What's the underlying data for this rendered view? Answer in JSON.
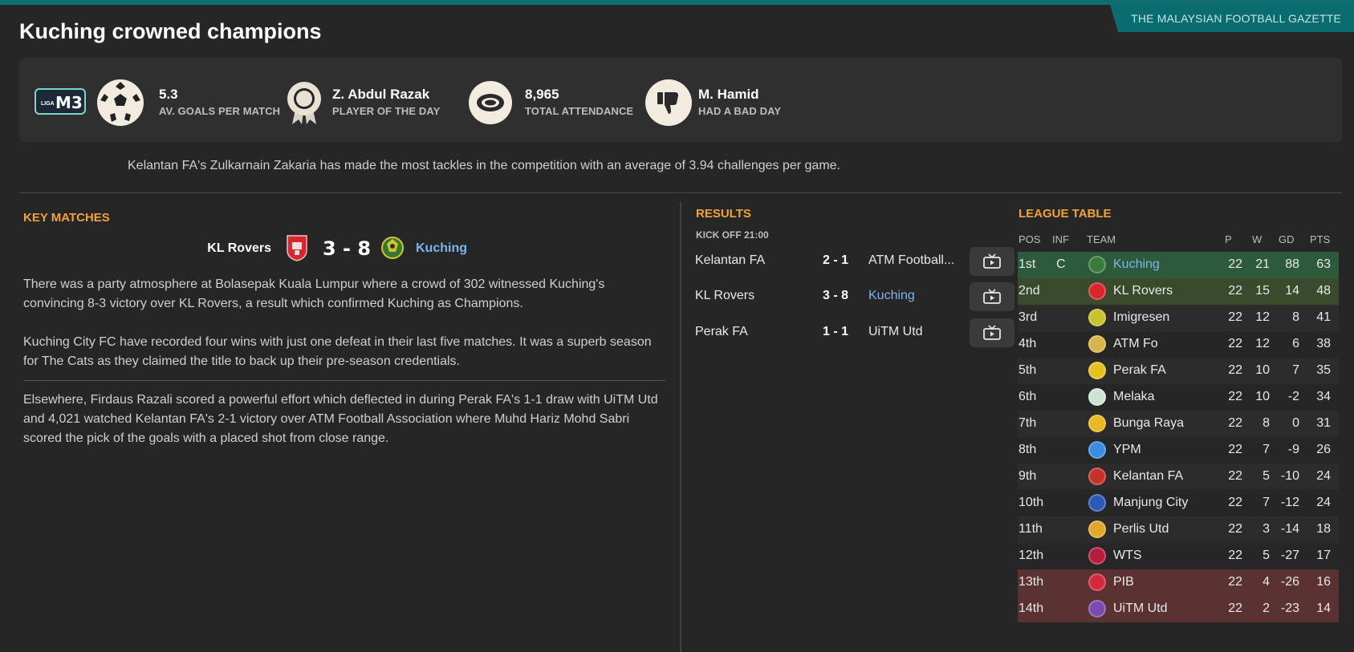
{
  "gazette": "THE MALAYSIAN FOOTBALL GAZETTE",
  "headline": "Kuching crowned champions",
  "league_logo": {
    "small": "LIGA",
    "big": "M3"
  },
  "stats": [
    {
      "icon": "football-icon",
      "value": "5.3",
      "label": "AV. GOALS PER MATCH"
    },
    {
      "icon": "rosette-icon",
      "value": "Z. Abdul Razak",
      "label": "PLAYER OF THE DAY"
    },
    {
      "icon": "stadium-icon",
      "value": "8,965",
      "label": "TOTAL ATTENDANCE"
    },
    {
      "icon": "thumbs-down-icon",
      "value": "M. Hamid",
      "label": "HAD A BAD DAY"
    }
  ],
  "fact": "Kelantan FA's Zulkarnain Zakaria has made the most tackles in the competition with an average of 3.94 challenges per game.",
  "key_matches": {
    "title": "KEY MATCHES",
    "home": "KL Rovers",
    "score": "3 - 8",
    "away": "Kuching",
    "paragraphs": [
      "There was a party atmosphere at Bolasepak Kuala Lumpur where a crowd of 302 witnessed Kuching's convincing 8-3 victory over KL Rovers, a result which confirmed Kuching as Champions.",
      "Kuching City FC have recorded four wins with just one defeat in their last five matches. It was a superb season for The Cats as they claimed the title to back up their pre-season credentials.",
      "Elsewhere, Firdaus Razali scored a powerful effort which deflected in during Perak FA's 1-1 draw with UiTM Utd and 4,021 watched Kelantan FA's 2-1 victory over ATM Football Association where Muhd Hariz Mohd Sabri scored the pick of the goals with a placed shot from close range."
    ]
  },
  "results": {
    "title": "RESULTS",
    "kickoff": "KICK OFF 21:00",
    "rows": [
      {
        "home": "Kelantan FA",
        "score": "2 - 1",
        "away": "ATM Football..."
      },
      {
        "home": "KL Rovers",
        "score": "3 - 8",
        "away": "Kuching"
      },
      {
        "home": "Perak FA",
        "score": "1 - 1",
        "away": "UiTM Utd"
      }
    ]
  },
  "league_table": {
    "title": "LEAGUE TABLE",
    "headers": {
      "pos": "POS",
      "inf": "INF",
      "team": "TEAM",
      "p": "P",
      "w": "W",
      "gd": "GD",
      "pts": "PTS"
    },
    "rows": [
      {
        "pos": "1st",
        "inf": "C",
        "team": "Kuching",
        "p": "22",
        "w": "21",
        "gd": "88",
        "pts": "63",
        "badge_color": "#3a7a3a"
      },
      {
        "pos": "2nd",
        "inf": "",
        "team": "KL Rovers",
        "p": "22",
        "w": "15",
        "gd": "14",
        "pts": "48",
        "badge_color": "#d9262c"
      },
      {
        "pos": "3rd",
        "inf": "",
        "team": "Imigresen",
        "p": "22",
        "w": "12",
        "gd": "8",
        "pts": "41",
        "badge_color": "#c9c22a"
      },
      {
        "pos": "4th",
        "inf": "",
        "team": "ATM Fo",
        "p": "22",
        "w": "12",
        "gd": "6",
        "pts": "38",
        "badge_color": "#d8b44a"
      },
      {
        "pos": "5th",
        "inf": "",
        "team": "Perak FA",
        "p": "22",
        "w": "10",
        "gd": "7",
        "pts": "35",
        "badge_color": "#e6c21e"
      },
      {
        "pos": "6th",
        "inf": "",
        "team": "Melaka",
        "p": "22",
        "w": "10",
        "gd": "-2",
        "pts": "34",
        "badge_color": "#cfe3d2"
      },
      {
        "pos": "7th",
        "inf": "",
        "team": "Bunga Raya",
        "p": "22",
        "w": "8",
        "gd": "0",
        "pts": "31",
        "badge_color": "#e7b820"
      },
      {
        "pos": "8th",
        "inf": "",
        "team": "YPM",
        "p": "22",
        "w": "7",
        "gd": "-9",
        "pts": "26",
        "badge_color": "#3a8de0"
      },
      {
        "pos": "9th",
        "inf": "",
        "team": "Kelantan FA",
        "p": "22",
        "w": "5",
        "gd": "-10",
        "pts": "24",
        "badge_color": "#c8302c"
      },
      {
        "pos": "10th",
        "inf": "",
        "team": "Manjung City",
        "p": "22",
        "w": "7",
        "gd": "-12",
        "pts": "24",
        "badge_color": "#2a5ab8"
      },
      {
        "pos": "11th",
        "inf": "",
        "team": "Perlis Utd",
        "p": "22",
        "w": "3",
        "gd": "-14",
        "pts": "18",
        "badge_color": "#e0a82a"
      },
      {
        "pos": "12th",
        "inf": "",
        "team": "WTS",
        "p": "22",
        "w": "5",
        "gd": "-27",
        "pts": "17",
        "badge_color": "#b81c3a"
      },
      {
        "pos": "13th",
        "inf": "",
        "team": "PIB",
        "p": "22",
        "w": "4",
        "gd": "-26",
        "pts": "16",
        "badge_color": "#d22a3a"
      },
      {
        "pos": "14th",
        "inf": "",
        "team": "UiTM Utd",
        "p": "22",
        "w": "2",
        "gd": "-23",
        "pts": "14",
        "badge_color": "#7a4ab0"
      }
    ]
  },
  "colors": {
    "accent": "#f2a23a",
    "link": "#7ab6f0",
    "gazette_bg": "#0b6c70",
    "champion_row": "#2c5a3a",
    "second_row": "#3a4a2c",
    "relegation_row": "#5a3232"
  }
}
